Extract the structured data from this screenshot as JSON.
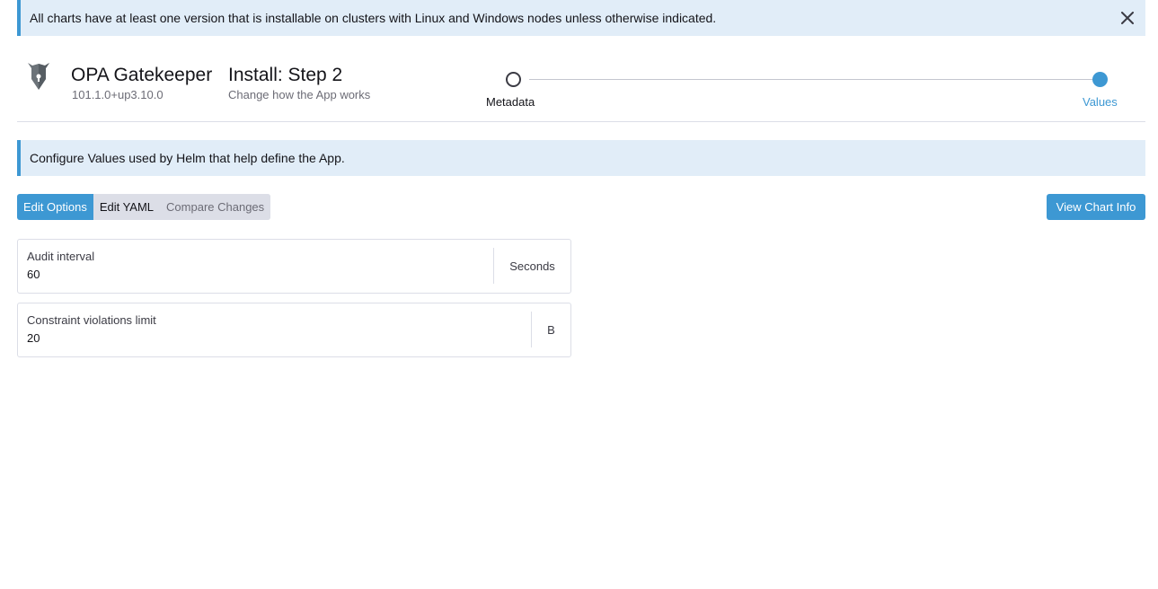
{
  "top_banner": {
    "text": "All charts have at least one version that is installable on clusters with Linux and Windows nodes unless otherwise indicated."
  },
  "app": {
    "name": "OPA Gatekeeper",
    "version": "101.1.0+up3.10.0"
  },
  "step": {
    "title": "Install: Step 2",
    "subtitle": "Change how the App works"
  },
  "progress": {
    "steps": [
      {
        "label": "Metadata",
        "state": "incomplete"
      },
      {
        "label": "Values",
        "state": "current"
      }
    ]
  },
  "info_banner": {
    "text": "Configure Values used by Helm that help define the App."
  },
  "tabs": [
    {
      "label": "Edit Options",
      "active": true
    },
    {
      "label": "Edit YAML",
      "active": false
    },
    {
      "label": "Compare Changes",
      "active": false
    }
  ],
  "view_chart_info": "View Chart Info",
  "fields": [
    {
      "label": "Audit interval",
      "value": "60",
      "suffix": "Seconds"
    },
    {
      "label": "Constraint violations limit",
      "value": "20",
      "suffix": "B"
    }
  ],
  "colors": {
    "accent": "#3d98d3",
    "banner_bg": "#e1edf8",
    "tab_bg": "#dcdee7"
  },
  "icons": {
    "close": "close-icon",
    "logo": "gatekeeper-logo-icon"
  }
}
